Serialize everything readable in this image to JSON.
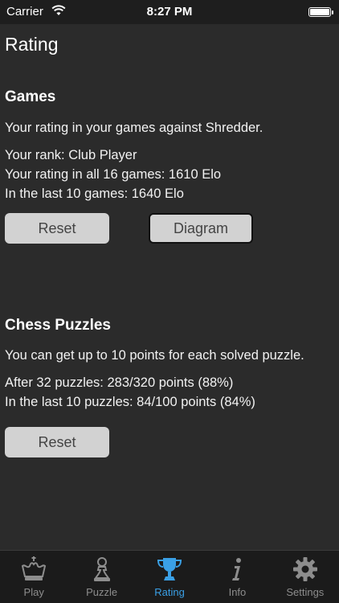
{
  "status_bar": {
    "carrier": "Carrier",
    "time": "8:27 PM"
  },
  "page": {
    "title": "Rating"
  },
  "games": {
    "title": "Games",
    "intro": "Your rating in your games against Shredder.",
    "rank": "Your rank: Club Player",
    "rating_all": "Your rating in all 16 games: 1610 Elo",
    "rating_last": "In the last 10 games: 1640 Elo",
    "reset_label": "Reset",
    "diagram_label": "Diagram"
  },
  "puzzles": {
    "title": "Chess Puzzles",
    "intro": "You can get up to 10 points for each solved puzzle.",
    "after": "After 32 puzzles: 283/320 points (88%)",
    "last": "In the last 10 puzzles: 84/100 points (84%)",
    "reset_label": "Reset"
  },
  "tabs": [
    {
      "label": "Play",
      "icon": "crown-icon"
    },
    {
      "label": "Puzzle",
      "icon": "pawn-icon"
    },
    {
      "label": "Rating",
      "icon": "trophy-icon"
    },
    {
      "label": "Info",
      "icon": "info-icon"
    },
    {
      "label": "Settings",
      "icon": "gear-icon"
    }
  ],
  "colors": {
    "accent": "#3aa0e6",
    "tab_inactive": "#8d8d8d",
    "background": "#2b2b2b"
  }
}
